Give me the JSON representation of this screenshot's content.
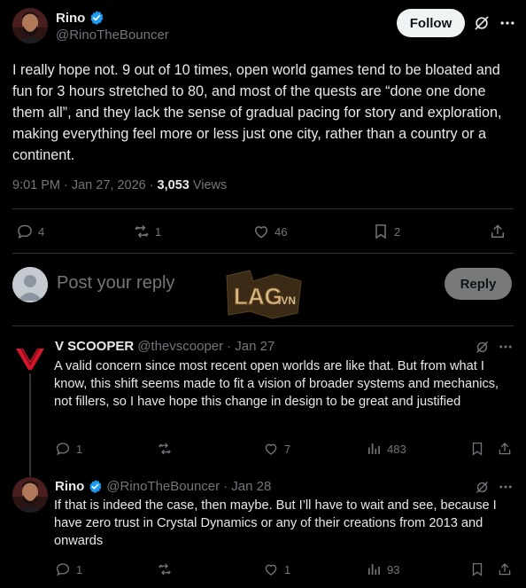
{
  "tweet": {
    "author_name": "Rino",
    "author_handle": "@RinoTheBouncer",
    "follow_label": "Follow",
    "text": "I really hope not. 9 out of 10 times, open world games tend to be bloated and fun for 3 hours stretched to 80, and most of the quests are “done one done them all”, and they lack the sense of gradual pacing for story and exploration, making everything feel more or less just one city, rather than a country or a continent.",
    "time": "9:01 PM",
    "date": "Jan 27, 2026",
    "separator": "·",
    "views_count": "3,053",
    "views_label": "Views",
    "replies": "4",
    "reposts": "1",
    "likes": "46",
    "bookmarks": "2"
  },
  "compose": {
    "placeholder": "Post your reply",
    "reply_label": "Reply"
  },
  "watermark": {
    "text": "LAG.VN"
  },
  "replies": [
    {
      "name": "V SCOOPER",
      "handle": "@thevscooper",
      "date": "· Jan 27",
      "text": "A valid concern since most recent open worlds are  like that. But from what I know, this shift seems made to fit a vision of broader systems and mechanics, not fillers, so I have hope this change in design to be great and justified",
      "replies": "1",
      "reposts": "",
      "likes": "7",
      "views": "483"
    },
    {
      "name": "Rino",
      "handle": "@RinoTheBouncer",
      "date": "· Jan 28",
      "text": "If that is indeed the case, then maybe. But I’ll have to wait and see, because I have zero trust in Crystal Dynamics or any of their creations from 2013 and onwards",
      "replies": "1",
      "reposts": "",
      "likes": "1",
      "views": "93"
    }
  ],
  "colors": {
    "background": "#000000",
    "text": "#e7e9ea",
    "muted": "#71767b",
    "verified": "#1d9bf0",
    "divider": "#2f3336",
    "vscooper_logo": "#d4162c"
  }
}
